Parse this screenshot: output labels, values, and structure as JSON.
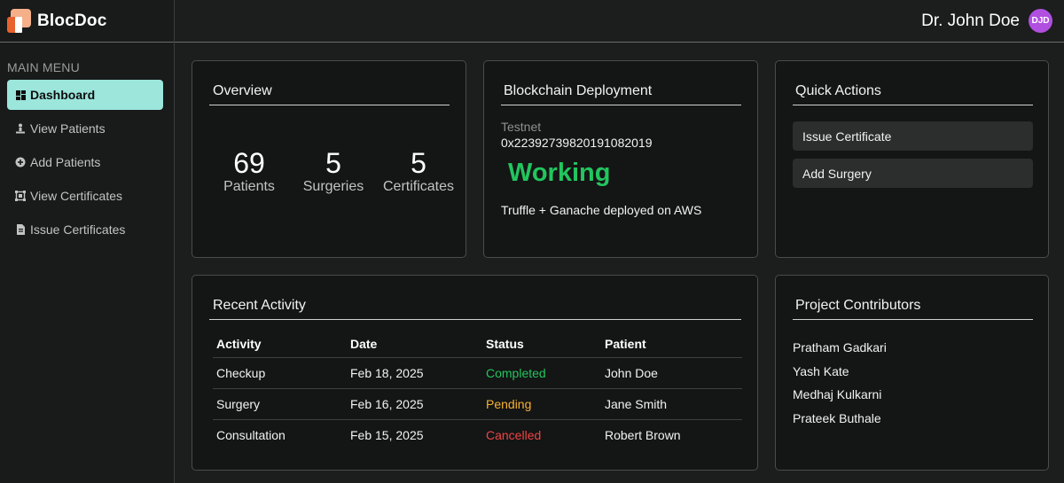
{
  "brand": {
    "name": "BlocDoc"
  },
  "header": {
    "user_name": "Dr. John Doe",
    "avatar_initials": "DJD"
  },
  "sidebar": {
    "section_label": "MAIN MENU",
    "items": [
      {
        "label": "Dashboard",
        "icon": "dashboard-icon",
        "active": true
      },
      {
        "label": "View Patients",
        "icon": "patient-icon"
      },
      {
        "label": "Add Patients",
        "icon": "add-circle-icon"
      },
      {
        "label": "View Certificates",
        "icon": "certificate-icon"
      },
      {
        "label": "Issue Certificates",
        "icon": "document-icon"
      }
    ]
  },
  "overview": {
    "title": "Overview",
    "stats": [
      {
        "value": "69",
        "label": "Patients"
      },
      {
        "value": "5",
        "label": "Surgeries"
      },
      {
        "value": "5",
        "label": "Certificates"
      }
    ]
  },
  "blockchain": {
    "title": "Blockchain Deployment",
    "network_label": "Testnet",
    "address": "0x2239273982019108​2019",
    "status": "Working",
    "description": "Truffle + Ganache deployed on AWS"
  },
  "quick_actions": {
    "title": "Quick Actions",
    "buttons": [
      "Issue Certificate",
      "Add Surgery"
    ]
  },
  "recent_activity": {
    "title": "Recent Activity",
    "columns": [
      "Activity",
      "Date",
      "Status",
      "Patient"
    ],
    "rows": [
      {
        "activity": "Checkup",
        "date": "Feb 18, 2025",
        "status": "Completed",
        "patient": "John Doe"
      },
      {
        "activity": "Surgery",
        "date": "Feb 16, 2025",
        "status": "Pending",
        "patient": "Jane Smith"
      },
      {
        "activity": "Consultation",
        "date": "Feb 15, 2025",
        "status": "Cancelled",
        "patient": "Robert Brown"
      }
    ]
  },
  "contributors": {
    "title": "Project Contributors",
    "names": [
      "Pratham Gadkari",
      "Yash Kate",
      "Medhaj Kulkarni",
      "Prateek Buthale"
    ]
  },
  "colors": {
    "accent": "#9ce6dc",
    "status_completed": "#22c55e",
    "status_pending": "#f5b133",
    "status_cancelled": "#ef4444",
    "avatar": "#b04fe0"
  }
}
